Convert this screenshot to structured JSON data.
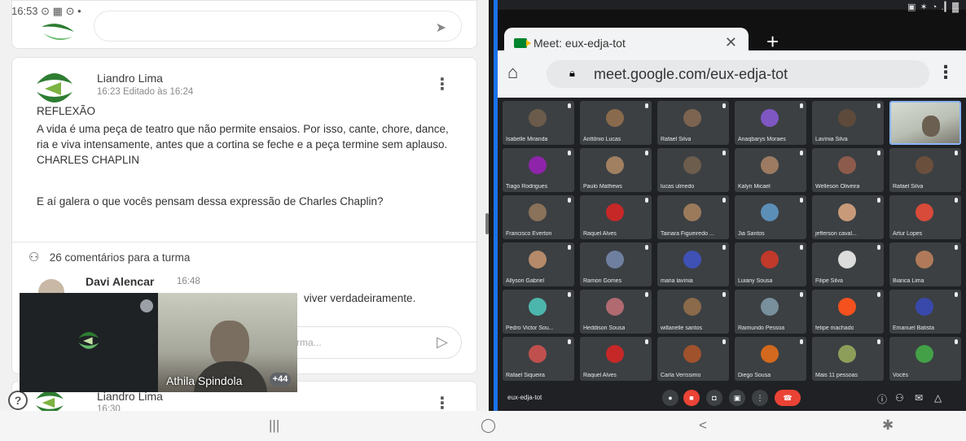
{
  "status_left": {
    "time": "16:53",
    "icons": "⊙ ▦ ⊙ •"
  },
  "status_right": {
    "icons": "▣ ✶ ◔ .▎▓"
  },
  "classroom": {
    "prev_send_icon": "send-icon",
    "post": {
      "author": "Liandro Lima",
      "meta": "16:23 Editado às 16:24",
      "title": "REFLEXÃO",
      "body": "A vida é uma peça de teatro que não permite ensaios. Por isso, cante, chore, dance, ria e viva intensamente,  antes que a cortina se feche e a peça termine sem aplauso. CHARLES CHAPLIN",
      "question": "E aí galera o que vocês pensam dessa expressão de Charles Chaplin?",
      "comments_label": "26 comentários para a turma",
      "comment": {
        "author": "Davi Alencar",
        "time": "16:48",
        "text_visible": "viver verdadeiramente."
      },
      "reply_placeholder": "rma..."
    },
    "post2": {
      "author": "Liandro Lima",
      "meta": "16:30"
    }
  },
  "pip": {
    "remote_name": "Athila Spindola",
    "count": "+44"
  },
  "chrome": {
    "tab_title": "Meet: eux-edja-tot",
    "url": "meet.google.com/eux-edja-tot"
  },
  "meet": {
    "meeting_code": "eux-edja-tot",
    "tiles": [
      {
        "name": "Isabelle Miranda",
        "color": "#6b5b4b"
      },
      {
        "name": "Anttônio Lucas",
        "color": "#8a6a4d"
      },
      {
        "name": "Rafael Silva",
        "color": "#7d6450"
      },
      {
        "name": "Anaqbarys Moraes",
        "color": "#7e57c2"
      },
      {
        "name": "Lavínia Silva",
        "color": "#5d4a3a"
      },
      {
        "name": "",
        "color": "#c7cbc0"
      },
      {
        "name": "Tiago Rodrigues",
        "color": "#8e24aa"
      },
      {
        "name": "Paulo Mathews",
        "color": "#a08060"
      },
      {
        "name": "lucas ulmedo",
        "color": "#6d5d4d"
      },
      {
        "name": "Kalyn Micael",
        "color": "#9c7b62"
      },
      {
        "name": "Welleson Oliveira",
        "color": "#8d5b4c"
      },
      {
        "name": "Rafael Silva",
        "color": "#6a4f3c"
      },
      {
        "name": "Francisco Everton",
        "color": "#8a7159"
      },
      {
        "name": "Raquel Alves",
        "color": "#c62828"
      },
      {
        "name": "Tainara Figueiredo ...",
        "color": "#9b7a5b"
      },
      {
        "name": "Jia Santos",
        "color": "#5c8fb8"
      },
      {
        "name": "jefferson caval...",
        "color": "#c89a7a"
      },
      {
        "name": "Artur Lopes",
        "color": "#d84a3a"
      },
      {
        "name": "Allyson Gabriel",
        "color": "#b48a6a"
      },
      {
        "name": "Ramon Gomes",
        "color": "#6f7fa0"
      },
      {
        "name": "maria lavínia",
        "color": "#3f51b5"
      },
      {
        "name": "Luiany Sousa",
        "color": "#c0392b"
      },
      {
        "name": "Filipe Silva",
        "color": "#dcdcdc"
      },
      {
        "name": "Bianca Lima",
        "color": "#b07a5a"
      },
      {
        "name": "Pedro Victor Sou...",
        "color": "#4db6ac"
      },
      {
        "name": "Heddison Sousa",
        "color": "#b06a70"
      },
      {
        "name": "willanelle santos",
        "color": "#8a6a4a"
      },
      {
        "name": "Raimundo Pessoa",
        "color": "#78909c"
      },
      {
        "name": "felipe machado",
        "color": "#f4511e"
      },
      {
        "name": "Emanuel Batista",
        "color": "#3949ab"
      },
      {
        "name": "Rafael Siqueira",
        "color": "#c0504d"
      },
      {
        "name": "Raquel Alves",
        "color": "#c62828"
      },
      {
        "name": "Carla Veríssimo",
        "color": "#a0522d"
      },
      {
        "name": "Diego Sousa",
        "color": "#d2691e"
      },
      {
        "name": "Mais 11 pessoas",
        "color": "#8d9e5a"
      },
      {
        "name": "Vocês",
        "color": "#43a047"
      }
    ]
  },
  "nav": {
    "recents": "|||",
    "home": "◯",
    "back": "<",
    "a11y": "✱"
  }
}
